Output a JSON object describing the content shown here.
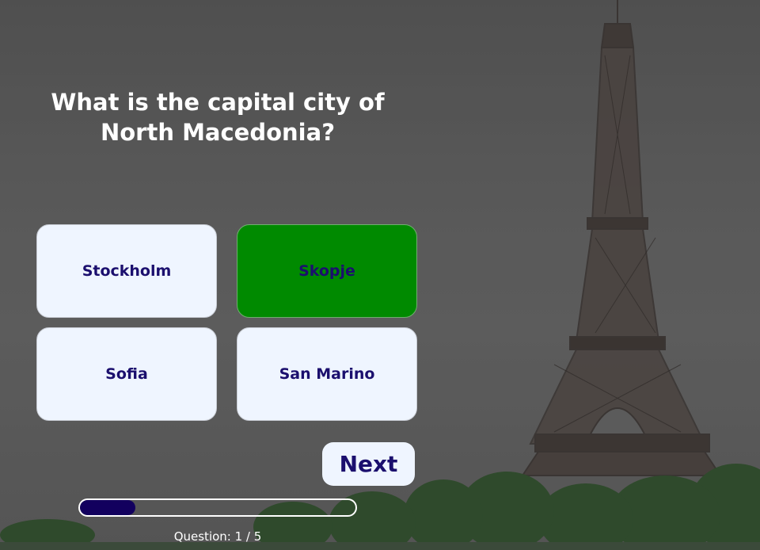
{
  "quiz": {
    "question": "What is the capital city of North Macedonia?",
    "answers": [
      {
        "label": "Stockholm",
        "state": "default"
      },
      {
        "label": "Skopje",
        "state": "correct"
      },
      {
        "label": "Sofia",
        "state": "default"
      },
      {
        "label": "San Marino",
        "state": "default"
      }
    ],
    "next_label": "Next",
    "progress_fraction": 0.2,
    "question_counter": "Question: 1 / 5"
  },
  "colors": {
    "answer_bg": "#eff5ff",
    "answer_text": "#1b0f6e",
    "correct_bg": "#008a00",
    "progress_fill": "#12005e"
  }
}
